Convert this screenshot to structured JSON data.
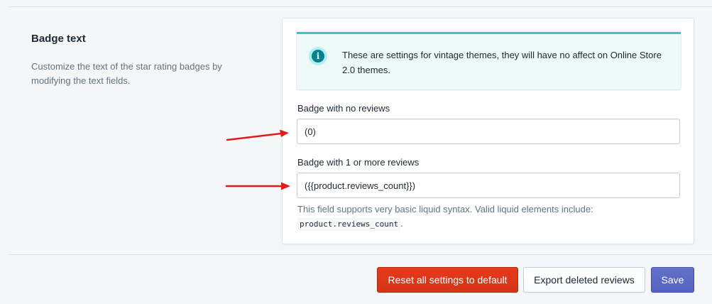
{
  "section": {
    "title": "Badge text",
    "description": "Customize the text of the star rating badges by modifying the text fields."
  },
  "banner": {
    "icon": "info-icon",
    "text": "These are settings for vintage themes, they will have no affect on Online Store 2.0 themes."
  },
  "fields": {
    "no_reviews": {
      "label": "Badge with no reviews",
      "value": "(0)"
    },
    "with_reviews": {
      "label": "Badge with 1 or more reviews",
      "value": "({{product.reviews_count}})",
      "help_text": "This field supports very basic liquid syntax. Valid liquid elements include:",
      "help_code": "product.reviews_count",
      "help_suffix": "."
    }
  },
  "actions": {
    "reset_label": "Reset all settings to default",
    "export_label": "Export deleted reviews",
    "save_label": "Save"
  },
  "colors": {
    "accent_teal": "#47c1bf",
    "danger": "#de3618",
    "primary": "#5c6ac4",
    "annotation_arrow": "#e01b1b"
  }
}
